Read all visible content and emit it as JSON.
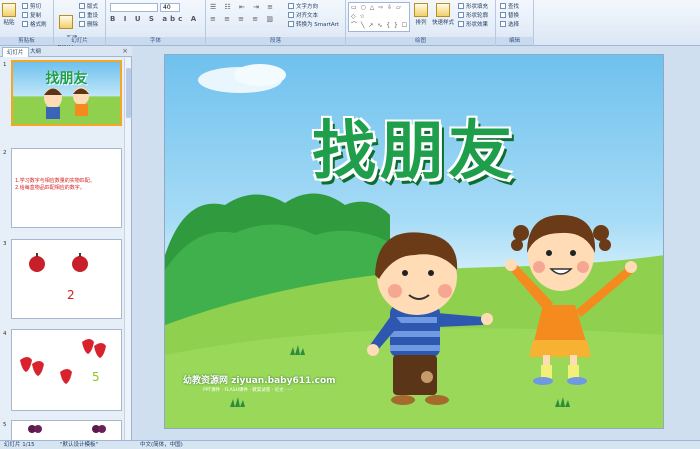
{
  "ribbon": {
    "clipboard": {
      "label": "剪贴板",
      "paste": "粘贴",
      "cut": "剪切",
      "copy": "复制",
      "format": "格式刷"
    },
    "slides": {
      "label": "幻灯片",
      "new_slide": "新建\n幻灯片",
      "layout": "版式",
      "reset": "重设",
      "delete": "删除"
    },
    "font": {
      "label": "字体",
      "font_name": "",
      "font_size": "40"
    },
    "paragraph": {
      "label": "段落",
      "text_direction": "文字方向",
      "align_text": "对齐文本",
      "smartart": "转换为 SmartArt"
    },
    "drawing": {
      "label": "绘图",
      "shapes_row1": "▭ ○ △ ⇨ ⇩ ▱ ◇ ☆",
      "shapes_row2": "⌒ ╲ ↗ ∿ { } ☐",
      "arrange": "排列",
      "quick_styles": "快速样式",
      "fill": "形状填充",
      "outline": "形状轮廓",
      "effects": "形状效果"
    },
    "editing": {
      "label": "编辑",
      "find": "查找",
      "replace": "替换",
      "select": "选择"
    }
  },
  "pane": {
    "tabs": [
      "幻灯片",
      "大纲"
    ],
    "close": "×",
    "slides": [
      {
        "num": "1",
        "title": "找朋友"
      },
      {
        "num": "2",
        "line1": "1.学习数字与相应数量的实物匹配。",
        "line2": "2.给每盒物品匹配相应的数字。"
      },
      {
        "num": "3",
        "digit": "2"
      },
      {
        "num": "4",
        "digit": "5"
      },
      {
        "num": "5"
      }
    ]
  },
  "slide": {
    "title": "找朋友",
    "watermark": "幼教资源网 ziyuan.baby611.com",
    "watermark_sub": "PPT课件 · FLASH课件 · 教案试卷 · 论文 · ···"
  },
  "status": {
    "slide_info": "幻灯片 1/15",
    "theme": "\"默认设计模板\"",
    "lang": "中文(简体，中国)"
  },
  "colors": {
    "title_green": "#1f9e4b",
    "grass": "#8fd14f",
    "sky": "#6fc1ee"
  }
}
